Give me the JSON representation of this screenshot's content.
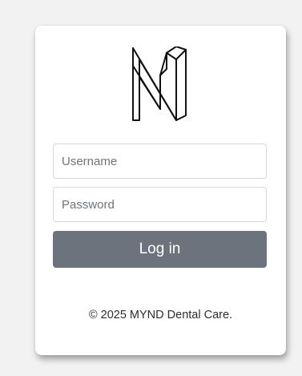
{
  "login": {
    "username_placeholder": "Username",
    "username_value": "",
    "password_placeholder": "Password",
    "password_value": "",
    "submit_label": "Log in"
  },
  "footer": {
    "copyright": "© 2025 MYND Dental Care."
  },
  "logo": {
    "icon": "mynd-m-logo-icon"
  },
  "colors": {
    "background": "#f2f2f3",
    "card": "#ffffff",
    "button": "#6c737c",
    "button_text": "#ffffff",
    "input_border": "#d6d9dc"
  }
}
